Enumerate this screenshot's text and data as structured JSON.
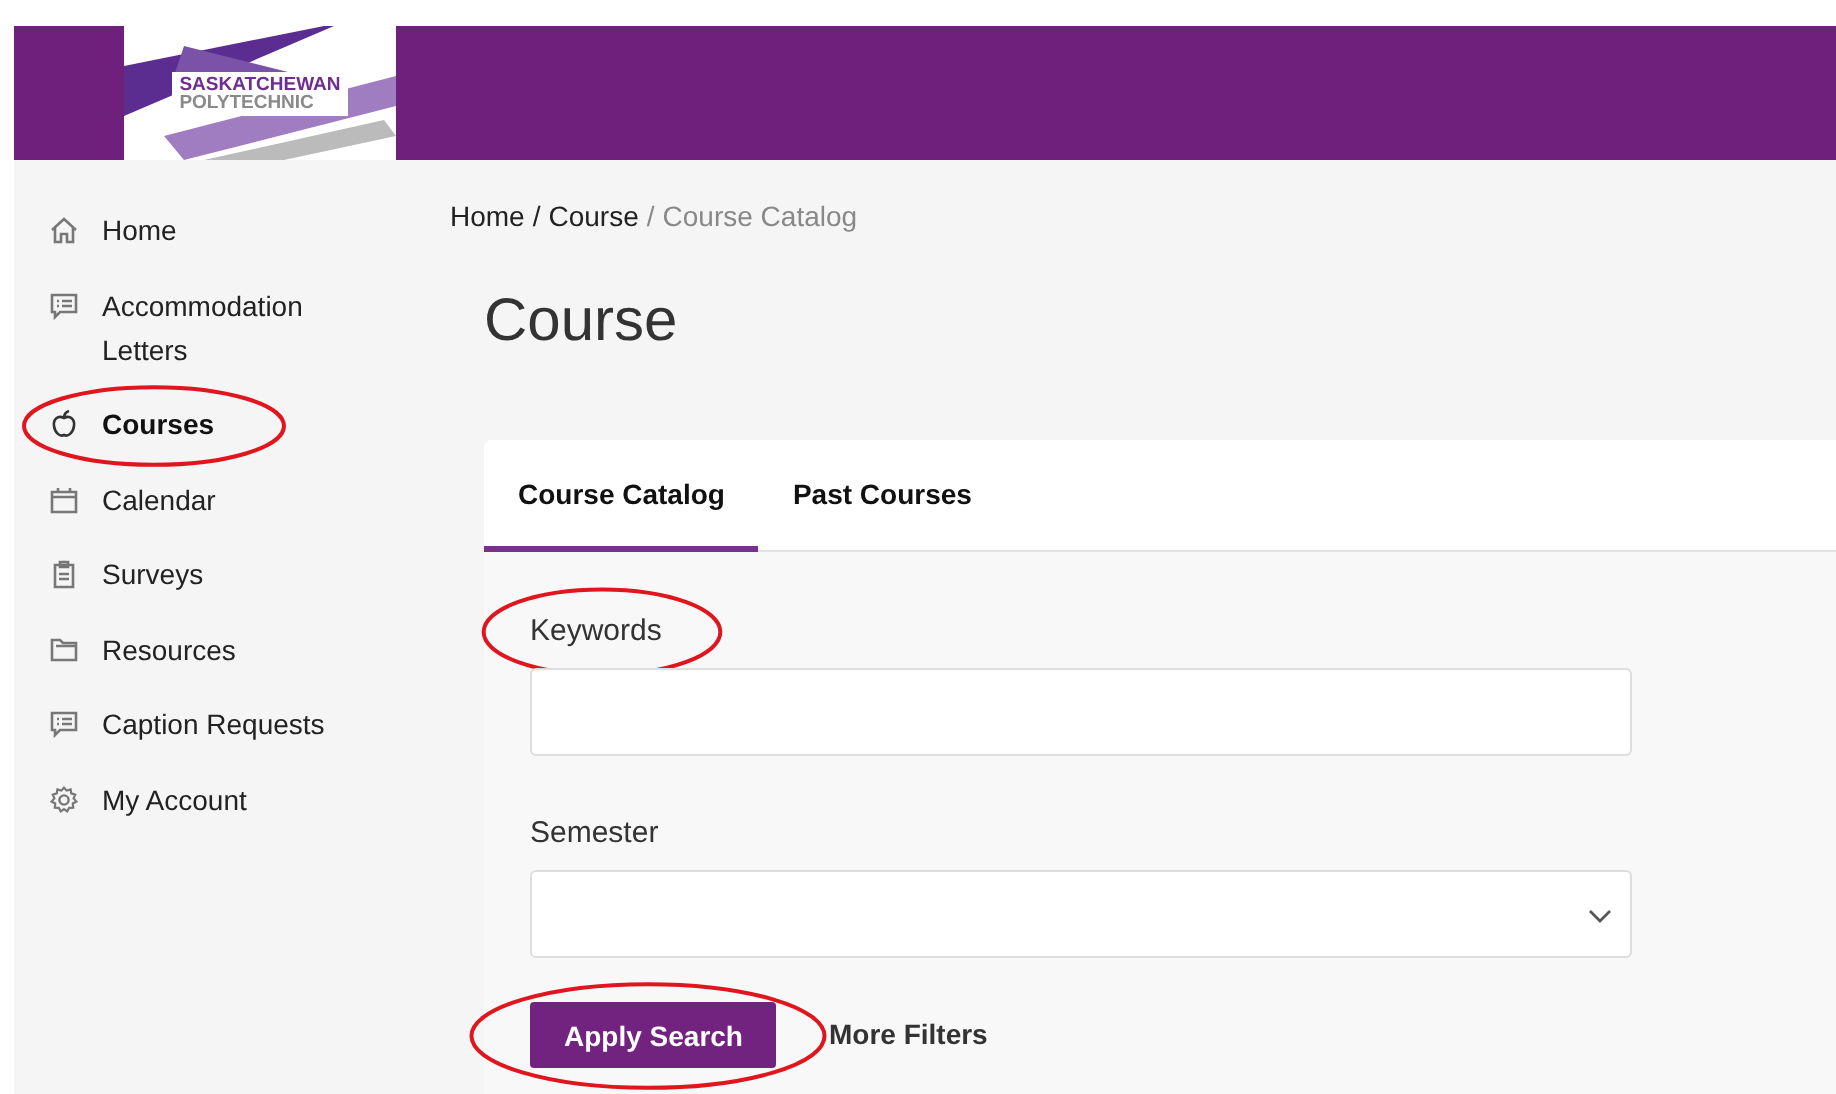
{
  "header": {
    "logo": {
      "lines": [
        "SASKATCHEWAN",
        "POLYTECHNIC"
      ]
    }
  },
  "sidebar": {
    "items": [
      {
        "label": "Home",
        "selected": false,
        "circled": false
      },
      {
        "label": "Accommodation Letters",
        "selected": false,
        "circled": false
      },
      {
        "label": "Courses",
        "selected": true,
        "circled": true
      },
      {
        "label": "Calendar",
        "selected": false,
        "circled": false
      },
      {
        "label": "Surveys",
        "selected": false,
        "circled": false
      },
      {
        "label": "Resources",
        "selected": false,
        "circled": false
      },
      {
        "label": "Caption Requests",
        "selected": false,
        "circled": false
      },
      {
        "label": "My Account",
        "selected": false,
        "circled": false
      }
    ]
  },
  "breadcrumb": [
    {
      "label": "Home",
      "current": false
    },
    {
      "label": "Course",
      "current": false
    },
    {
      "label": "Course Catalog",
      "current": true
    }
  ],
  "breadcrumb_separator": "/",
  "title": "Course",
  "tabs": [
    {
      "label": "Course Catalog",
      "selected": true
    },
    {
      "label": "Past Courses",
      "selected": false
    }
  ],
  "fields": [
    {
      "label": "Keywords",
      "kind": "text",
      "circled": true
    },
    {
      "label": "Semester",
      "kind": "select",
      "circled": false
    }
  ],
  "actions": [
    {
      "label": "Apply Search",
      "kind": "primary",
      "circled": true
    },
    {
      "label": "More Filters",
      "kind": "link",
      "circled": false
    }
  ]
}
